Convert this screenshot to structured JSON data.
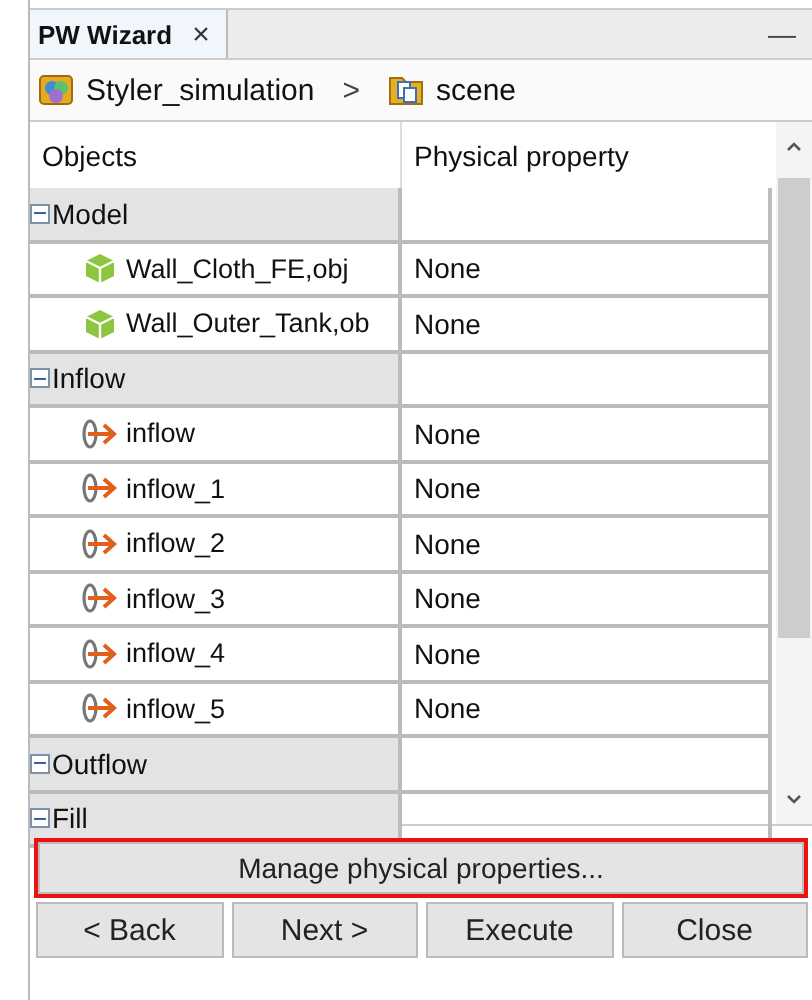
{
  "tab": {
    "label": "PW Wizard",
    "close": "×",
    "minimize": "—"
  },
  "breadcrumb": [
    {
      "kind": "project",
      "label": "Styler_simulation"
    },
    {
      "kind": "separator",
      "label": ">"
    },
    {
      "kind": "scene",
      "label": "scene"
    }
  ],
  "table": {
    "columns": [
      "Objects",
      "Physical property"
    ],
    "groups": [
      {
        "label": "Model",
        "expanded": true,
        "children": [
          {
            "kind": "model",
            "label": "Wall_Cloth_FE,obj",
            "property": "None"
          },
          {
            "kind": "model",
            "label": "Wall_Outer_Tank,ob",
            "property": "None"
          }
        ]
      },
      {
        "label": "Inflow",
        "expanded": true,
        "children": [
          {
            "kind": "inflow",
            "label": "inflow",
            "property": "None"
          },
          {
            "kind": "inflow",
            "label": "inflow_1",
            "property": "None"
          },
          {
            "kind": "inflow",
            "label": "inflow_2",
            "property": "None"
          },
          {
            "kind": "inflow",
            "label": "inflow_3",
            "property": "None"
          },
          {
            "kind": "inflow",
            "label": "inflow_4",
            "property": "None"
          },
          {
            "kind": "inflow",
            "label": "inflow_5",
            "property": "None"
          }
        ]
      },
      {
        "label": "Outflow",
        "expanded": true
      },
      {
        "label": "Fill",
        "expanded": true
      }
    ]
  },
  "manage_button": {
    "label": "Manage physical properties...",
    "highlighted": true
  },
  "buttons": [
    "< Back",
    "Next >",
    "Execute",
    "Close"
  ]
}
